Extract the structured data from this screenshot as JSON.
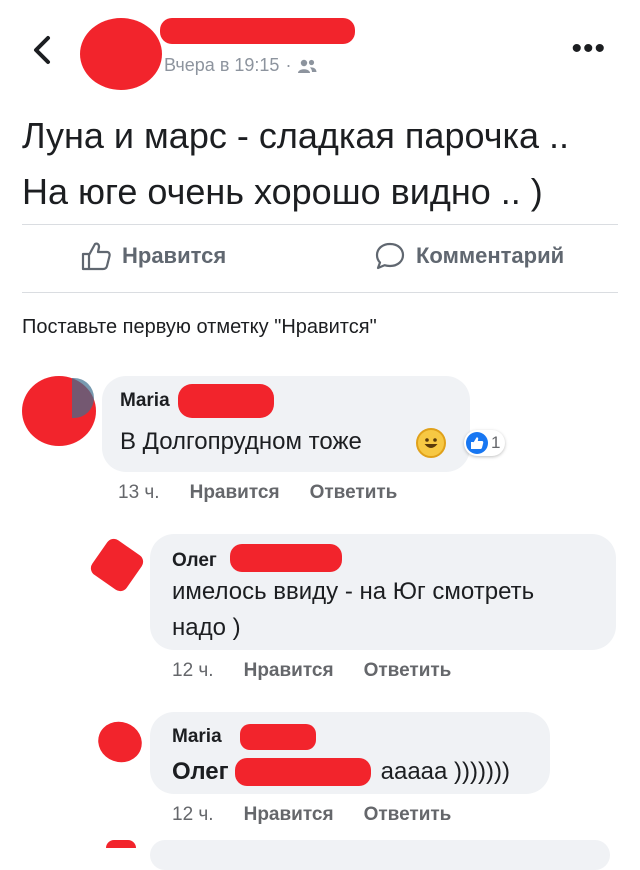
{
  "header": {
    "timestamp": "Вчера в 19:15",
    "dot": "·",
    "audience_icon": "friends-icon",
    "more_label": "•••"
  },
  "post": {
    "text_line1": "Луна и марс - сладкая парочка ..",
    "text_line2": "На юге очень хорошо видно .. )"
  },
  "actions": {
    "like_label": "Нравится",
    "comment_label": "Комментарий"
  },
  "first_like_text": "Поставьте первую отметку \"Нравится\"",
  "comments": [
    {
      "name": "Maria",
      "text": "В Долгопрудном тоже",
      "reaction_count": "1",
      "time": "13 ч.",
      "like": "Нравится",
      "reply": "Ответить"
    },
    {
      "name": "Олег",
      "text": "имелось ввиду - на Юг смотреть надо )",
      "time": "12 ч.",
      "like": "Нравится",
      "reply": "Ответить"
    },
    {
      "name": "Maria",
      "mention": "Олег",
      "text": "ааааа )))))))",
      "time": "12 ч.",
      "like": "Нравится",
      "reply": "Ответить"
    }
  ],
  "colors": {
    "accent": "#1877f2",
    "redaction": "#f2242c",
    "bubble": "#f0f2f5"
  }
}
